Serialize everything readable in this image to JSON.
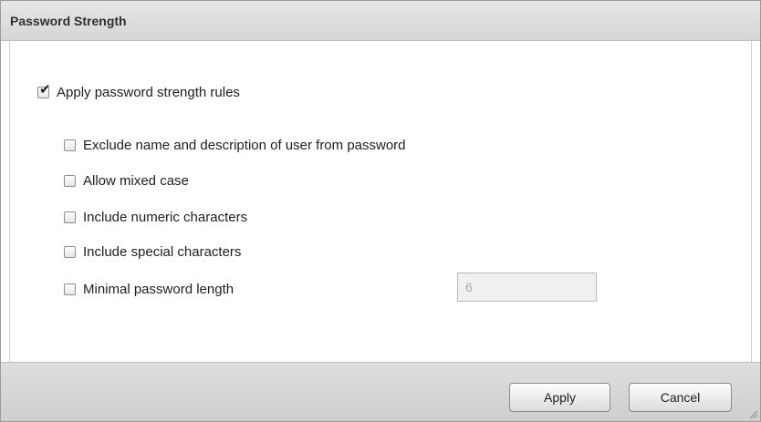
{
  "dialog": {
    "title": "Password Strength"
  },
  "options": {
    "master": {
      "label": "Apply password strength rules",
      "checked": true
    },
    "items": [
      {
        "label": "Exclude name and description of user from password",
        "checked": false
      },
      {
        "label": "Allow mixed case",
        "checked": false
      },
      {
        "label": "Include numeric characters",
        "checked": false
      },
      {
        "label": "Include special characters",
        "checked": false
      },
      {
        "label": "Minimal password length",
        "checked": false
      }
    ]
  },
  "min_length": {
    "value": "6",
    "disabled": true
  },
  "footer": {
    "apply_label": "Apply",
    "cancel_label": "Cancel"
  },
  "icons": {
    "check": "checkmark-icon",
    "resize": "resize-grip-icon"
  }
}
